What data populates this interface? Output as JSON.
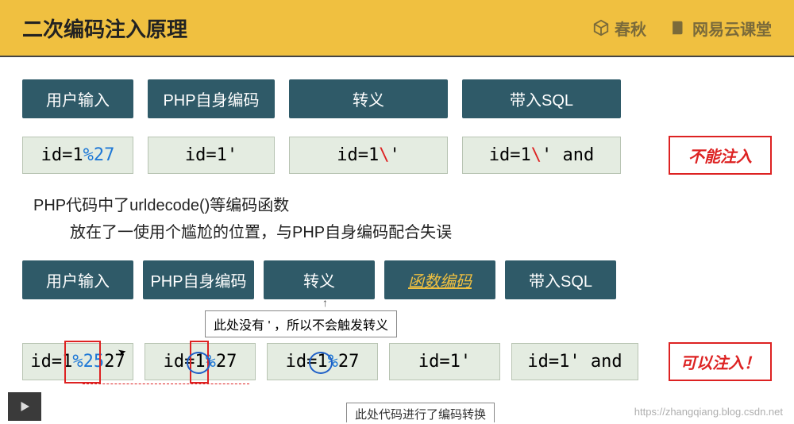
{
  "header": {
    "title": "二次编码注入原理",
    "logo1": "春秋",
    "logo2": "网易云课堂"
  },
  "row1": {
    "headers": [
      "用户输入",
      "PHP自身编码",
      "转义",
      "带入SQL"
    ]
  },
  "row2": {
    "cells": [
      {
        "pre": "id=1",
        "pct": "%27",
        "post": ""
      },
      {
        "pre": "id=1'",
        "pct": "",
        "post": ""
      },
      {
        "pre": "id=1",
        "bslash": "\\",
        "post": "'"
      },
      {
        "pre": "id=1",
        "bslash": "\\",
        "post": "' and"
      }
    ],
    "result": "不能注入"
  },
  "explain": {
    "line1": "PHP代码中了urldecode()等编码函数",
    "line2": "放在了一使用个尴尬的位置，与PHP自身编码配合失误"
  },
  "row3": {
    "headers": [
      "用户输入",
      "PHP自身编码",
      "转义",
      "函数编码",
      "带入SQL"
    ]
  },
  "callout1": "此处没有 ' ，所以不会触发转义",
  "row4": {
    "cells": [
      {
        "pre": "id=1",
        "pct": "%25",
        "post": "27"
      },
      {
        "pre": "id=1",
        "pct": "%",
        "post": "27"
      },
      {
        "pre": "id=1",
        "pct": "%",
        "post": "27"
      },
      {
        "pre": "id=1'",
        "pct": "",
        "post": ""
      },
      {
        "pre": "id=1' and",
        "pct": "",
        "post": ""
      }
    ],
    "result": "可以注入！"
  },
  "bottom_callout": "此处代码进行了编码转换",
  "watermark": "https://zhangqiang.blog.csdn.net"
}
